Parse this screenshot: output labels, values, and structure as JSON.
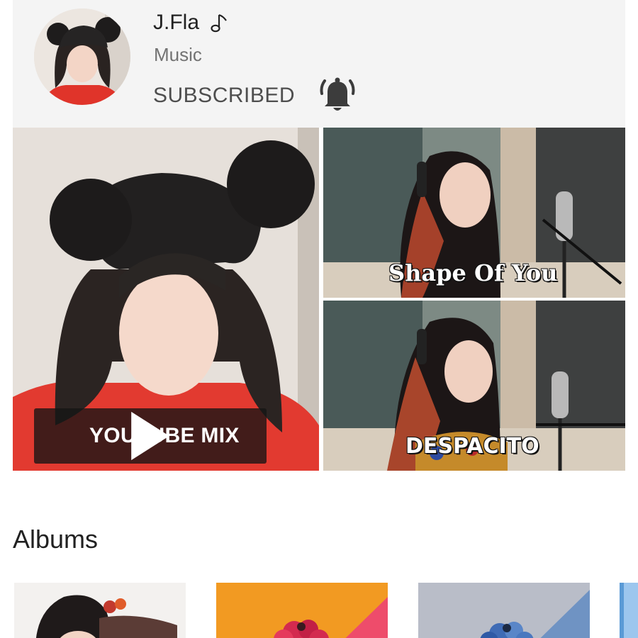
{
  "channel": {
    "name": "J.Fla",
    "category": "Music",
    "subscribe_label": "SUBSCRIBED",
    "music_icon": "music-note-icon",
    "bell_icon": "bell-icon"
  },
  "tiles": {
    "mix_label": "YOUTUBE MIX",
    "videos": [
      {
        "title": "Shape Of You"
      },
      {
        "title": "DESPACITO"
      }
    ]
  },
  "albums": {
    "section_title": "Albums"
  },
  "colors": {
    "header_bg": "#f4f4f4",
    "album2_orange": "#f29a22",
    "album2_pink": "#ee4c6b",
    "album3_blue": "#6f93c3"
  }
}
